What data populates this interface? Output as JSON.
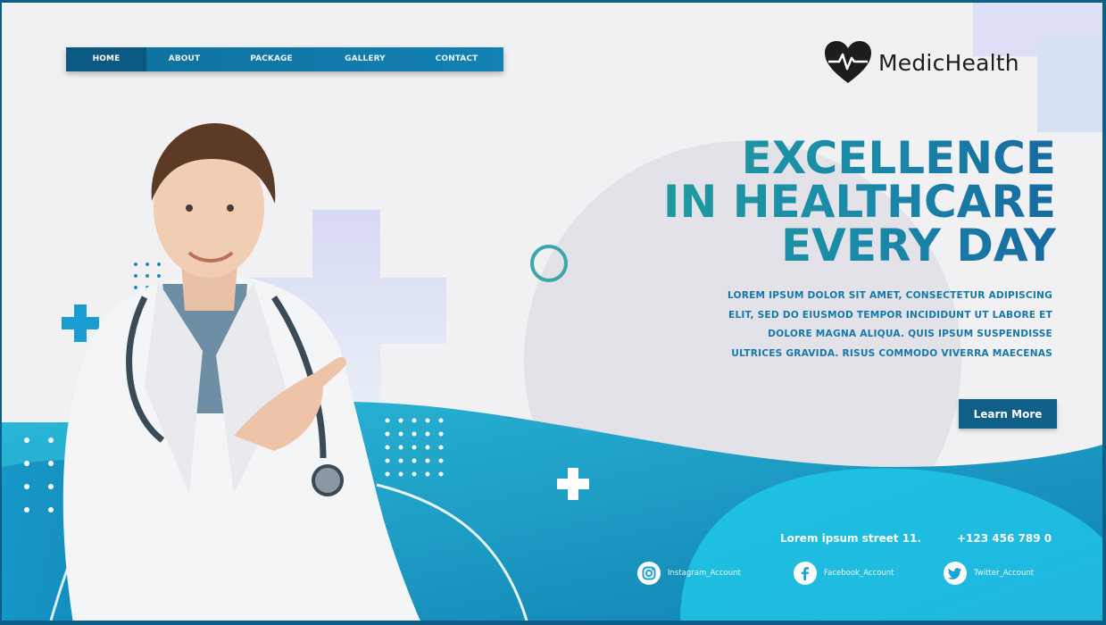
{
  "nav": {
    "items": [
      "HOME",
      "ABOUT",
      "PACKAGE",
      "GALLERY",
      "CONTACT"
    ],
    "active": "HOME"
  },
  "logo": {
    "text": "MedicHealth",
    "icon": "heart-pulse-icon"
  },
  "hero": {
    "headline": [
      "EXCELLENCE",
      "IN HEALTHCARE",
      "EVERY DAY"
    ],
    "body": [
      "LOREM IPSUM DOLOR SIT AMET, CONSECTETUR ADIPISCING",
      "ELIT, SED DO EIUSMOD TEMPOR INCIDIDUNT UT LABORE ET",
      "DOLORE MAGNA ALIQUA. QUIS IPSUM SUSPENDISSE",
      "ULTRICES GRAVIDA. RISUS COMMODO VIVERRA MAECENAS"
    ],
    "cta_label": "Learn More"
  },
  "contact": {
    "address": "Lorem ipsum street 11.",
    "phone": "+123 456 789 0"
  },
  "social": [
    {
      "label": "Instagram_Account",
      "icon": "instagram-icon"
    },
    {
      "label": "Facebook_Account",
      "icon": "facebook-icon"
    },
    {
      "label": "Twitter_Account",
      "icon": "twitter-icon"
    }
  ],
  "colors": {
    "primary": "#0f5f88",
    "accent": "#1a9aa6",
    "cyan": "#18aedb",
    "background": "#f1f0f2"
  }
}
